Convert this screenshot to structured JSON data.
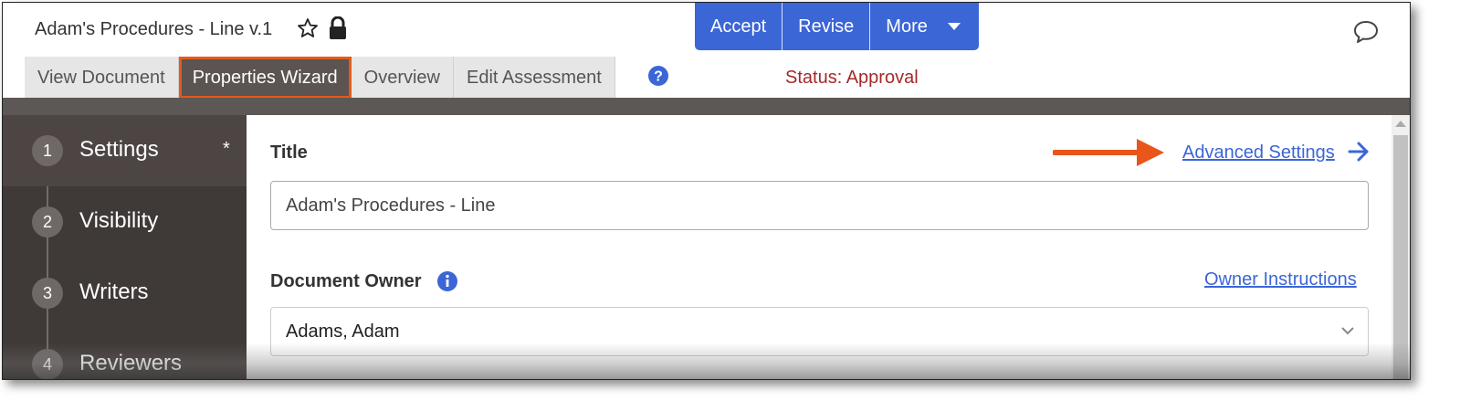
{
  "header": {
    "document_title": "Adam's Procedures - Line v.1",
    "icons": {
      "favorite": "star-icon",
      "lock": "lock-icon",
      "comments": "comment-icon"
    }
  },
  "actions": {
    "accept_label": "Accept",
    "revise_label": "Revise",
    "more_label": "More"
  },
  "tabs": [
    {
      "label": "View Document",
      "active": false
    },
    {
      "label": "Properties Wizard",
      "active": true
    },
    {
      "label": "Overview",
      "active": false
    },
    {
      "label": "Edit Assessment",
      "active": false
    }
  ],
  "status_text": "Status: Approval",
  "wizard": {
    "steps": [
      {
        "number": "1",
        "label": "Settings",
        "marker": "*",
        "active": true
      },
      {
        "number": "2",
        "label": "Visibility",
        "active": false
      },
      {
        "number": "3",
        "label": "Writers",
        "active": false
      },
      {
        "number": "4",
        "label": "Reviewers",
        "active": false
      }
    ]
  },
  "form": {
    "title_label": "Title",
    "advanced_settings_link": "Advanced Settings",
    "title_value": "Adam's Procedures - Line",
    "owner_label": "Document Owner",
    "owner_instructions_link": "Owner Instructions",
    "owner_value": "Adams, Adam"
  },
  "colors": {
    "primary": "#3b66d6",
    "sidebar": "#3f3937",
    "highlight": "#e45b1c",
    "status": "#a4292a"
  }
}
